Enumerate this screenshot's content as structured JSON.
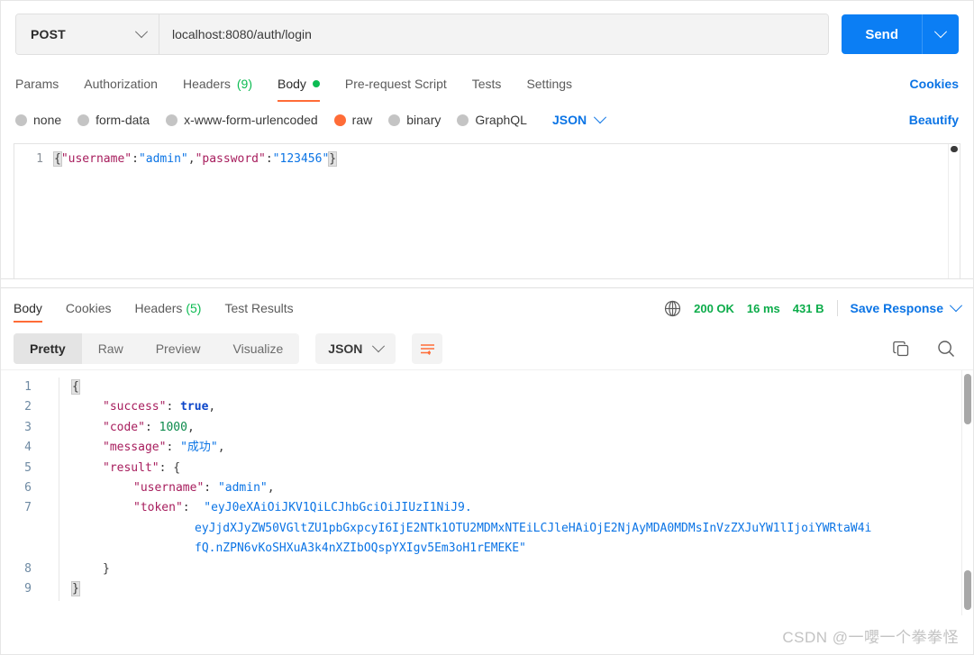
{
  "request": {
    "method": "POST",
    "url": "localhost:8080/auth/login",
    "send_label": "Send",
    "tabs": [
      {
        "label": "Params",
        "active": false
      },
      {
        "label": "Authorization",
        "active": false
      },
      {
        "label": "Headers",
        "count": "(9)",
        "active": false
      },
      {
        "label": "Body",
        "active": true,
        "has_dot": true
      },
      {
        "label": "Pre-request Script",
        "active": false
      },
      {
        "label": "Tests",
        "active": false
      },
      {
        "label": "Settings",
        "active": false
      }
    ],
    "cookies_link": "Cookies",
    "beautify_link": "Beautify",
    "body_types": [
      {
        "label": "none",
        "selected": false
      },
      {
        "label": "form-data",
        "selected": false
      },
      {
        "label": "x-www-form-urlencoded",
        "selected": false
      },
      {
        "label": "raw",
        "selected": true
      },
      {
        "label": "binary",
        "selected": false
      },
      {
        "label": "GraphQL",
        "selected": false
      }
    ],
    "raw_format": "JSON",
    "editor": {
      "line_number": "1",
      "open_brace": "{",
      "key_username": "\"username\"",
      "colon1": ":",
      "val_admin": "\"admin\"",
      "comma": ",",
      "key_password": "\"password\"",
      "colon2": ":",
      "val_password": "\"123456\"",
      "close_brace": "}"
    }
  },
  "response": {
    "tabs": [
      {
        "label": "Body",
        "active": true
      },
      {
        "label": "Cookies",
        "active": false
      },
      {
        "label": "Headers",
        "count": "(5)",
        "active": false
      },
      {
        "label": "Test Results",
        "active": false
      }
    ],
    "status": "200 OK",
    "time": "16 ms",
    "size": "431 B",
    "save_response": "Save Response",
    "view_modes": [
      {
        "label": "Pretty",
        "active": true
      },
      {
        "label": "Raw",
        "active": false
      },
      {
        "label": "Preview",
        "active": false
      },
      {
        "label": "Visualize",
        "active": false
      }
    ],
    "format": "JSON",
    "body_lines": [
      {
        "num": "1",
        "indent": 0,
        "segments": [
          {
            "t": "{",
            "c": "brace-hl"
          }
        ]
      },
      {
        "num": "2",
        "indent": 1,
        "segments": [
          {
            "t": "\"success\"",
            "c": "tk-keyred"
          },
          {
            "t": ": ",
            "c": "tk-punc"
          },
          {
            "t": "true",
            "c": "tk-bool"
          },
          {
            "t": ",",
            "c": "tk-punc"
          }
        ]
      },
      {
        "num": "3",
        "indent": 1,
        "segments": [
          {
            "t": "\"code\"",
            "c": "tk-keyred"
          },
          {
            "t": ": ",
            "c": "tk-punc"
          },
          {
            "t": "1000",
            "c": "tk-num"
          },
          {
            "t": ",",
            "c": "tk-punc"
          }
        ]
      },
      {
        "num": "4",
        "indent": 1,
        "segments": [
          {
            "t": "\"message\"",
            "c": "tk-keyred"
          },
          {
            "t": ": ",
            "c": "tk-punc"
          },
          {
            "t": "\"成功\"",
            "c": "tk-str"
          },
          {
            "t": ",",
            "c": "tk-punc"
          }
        ]
      },
      {
        "num": "5",
        "indent": 1,
        "segments": [
          {
            "t": "\"result\"",
            "c": "tk-keyred"
          },
          {
            "t": ": ",
            "c": "tk-punc"
          },
          {
            "t": "{",
            "c": "tk-punc"
          }
        ]
      },
      {
        "num": "6",
        "indent": 2,
        "segments": [
          {
            "t": "\"username\"",
            "c": "tk-keyred"
          },
          {
            "t": ": ",
            "c": "tk-punc"
          },
          {
            "t": "\"admin\"",
            "c": "tk-str"
          },
          {
            "t": ",",
            "c": "tk-punc"
          }
        ]
      },
      {
        "num": "7",
        "indent": 2,
        "segments": [
          {
            "t": "\"token\"",
            "c": "tk-keyred"
          },
          {
            "t": ":  ",
            "c": "tk-punc"
          },
          {
            "t": "\"eyJ0eXAiOiJKV1QiLCJhbGciOiJIUzI1NiJ9.",
            "c": "tk-str"
          }
        ]
      },
      {
        "num": "",
        "indent": 4,
        "segments": [
          {
            "t": "eyJjdXJyZW50VGltZU1pbGxpcyI6IjE2NTk1OTU2MDMxNTEiLCJleHAiOjE2NjAyMDA0MDMsInVzZXJuYW1lIjoiYWRtaW4i",
            "c": "tk-str"
          }
        ]
      },
      {
        "num": "",
        "indent": 4,
        "segments": [
          {
            "t": "fQ.nZPN6vKoSHXuA3k4nXZIbOQspYXIgv5Em3oH1rEMEKE\"",
            "c": "tk-str"
          }
        ]
      },
      {
        "num": "8",
        "indent": 1,
        "segments": [
          {
            "t": "}",
            "c": "tk-punc"
          }
        ]
      },
      {
        "num": "9",
        "indent": 0,
        "segments": [
          {
            "t": "}",
            "c": "brace-hl"
          }
        ]
      }
    ]
  },
  "watermark": "CSDN @一嚶一个拳拳怪",
  "colors": {
    "accent_orange": "#ff6c37",
    "brand_blue": "#0b7ef4",
    "link_blue": "#0b74e5",
    "status_green": "#0cac4a"
  }
}
